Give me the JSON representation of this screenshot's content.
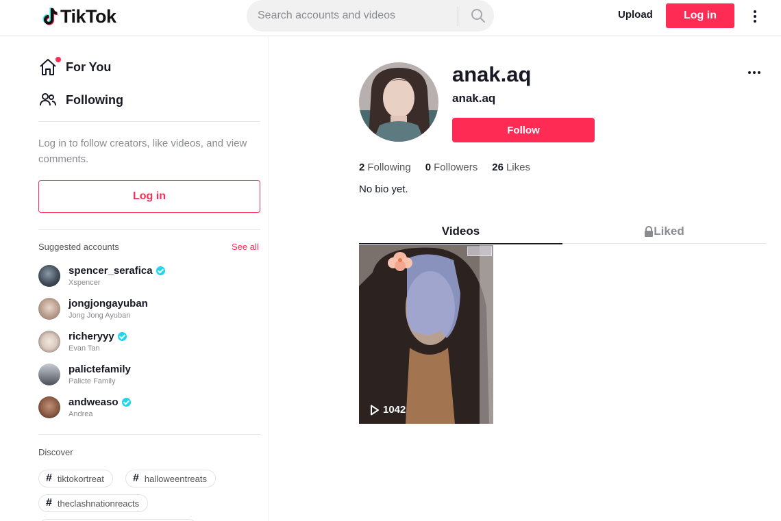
{
  "header": {
    "logo_text": "TikTok",
    "search_placeholder": "Search accounts and videos",
    "upload_label": "Upload",
    "login_label": "Log in"
  },
  "sidebar": {
    "nav": [
      {
        "label": "For You",
        "icon": "home-icon"
      },
      {
        "label": "Following",
        "icon": "people-icon"
      }
    ],
    "login_hint": "Log in to follow creators, like videos, and view comments.",
    "login_label": "Log in",
    "suggested_title": "Suggested accounts",
    "see_all_label": "See all",
    "accounts": [
      {
        "username": "spencer_serafica",
        "nickname": "Xspencer",
        "verified": true
      },
      {
        "username": "jongjongayuban",
        "nickname": "Jong Jong Ayuban",
        "verified": false
      },
      {
        "username": "richeryyy",
        "nickname": "Evan Tan",
        "verified": true
      },
      {
        "username": "palictefamily",
        "nickname": "Palicte Family",
        "verified": false
      },
      {
        "username": "andweaso",
        "nickname": "Andrea",
        "verified": true
      }
    ],
    "discover_title": "Discover",
    "tags": [
      "tiktokortreat",
      "halloweentreats",
      "theclashnationreacts"
    ]
  },
  "profile": {
    "title": "anak.aq",
    "subtitle": "anak.aq",
    "follow_label": "Follow",
    "stats": {
      "following_count": "2",
      "following_label": "Following",
      "followers_count": "0",
      "followers_label": "Followers",
      "likes_count": "26",
      "likes_label": "Likes"
    },
    "bio": "No bio yet.",
    "tabs": {
      "videos": "Videos",
      "liked": "Liked"
    },
    "videos": [
      {
        "views": "1042"
      }
    ]
  },
  "colors": {
    "accent": "#fe2c55",
    "verified": "#20d5ec",
    "text": "#161823",
    "muted": "#8a8b91"
  }
}
